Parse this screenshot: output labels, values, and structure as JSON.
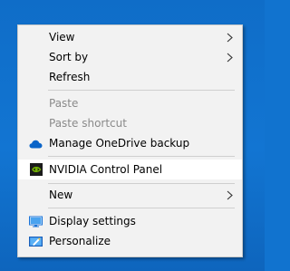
{
  "context_menu": {
    "items": [
      {
        "label": "View",
        "has_submenu": true,
        "enabled": true
      },
      {
        "label": "Sort by",
        "has_submenu": true,
        "enabled": true
      },
      {
        "label": "Refresh",
        "has_submenu": false,
        "enabled": true
      },
      {
        "label": "Paste",
        "has_submenu": false,
        "enabled": false
      },
      {
        "label": "Paste shortcut",
        "has_submenu": false,
        "enabled": false
      },
      {
        "label": "Manage OneDrive backup",
        "icon": "onedrive-cloud-icon",
        "enabled": true
      },
      {
        "label": "NVIDIA Control Panel",
        "icon": "nvidia-icon",
        "enabled": true,
        "highlighted": true
      },
      {
        "label": "New",
        "has_submenu": true,
        "enabled": true
      },
      {
        "label": "Display settings",
        "icon": "display-icon",
        "enabled": true
      },
      {
        "label": "Personalize",
        "icon": "personalize-icon",
        "enabled": true
      }
    ]
  },
  "colors": {
    "desktop": "#1173cf",
    "menu_background": "#f2f2f2",
    "highlight": "#ffffff",
    "disabled_text": "#8a8a8a",
    "onedrive": "#0a64c8",
    "nvidia": "#76b900"
  }
}
